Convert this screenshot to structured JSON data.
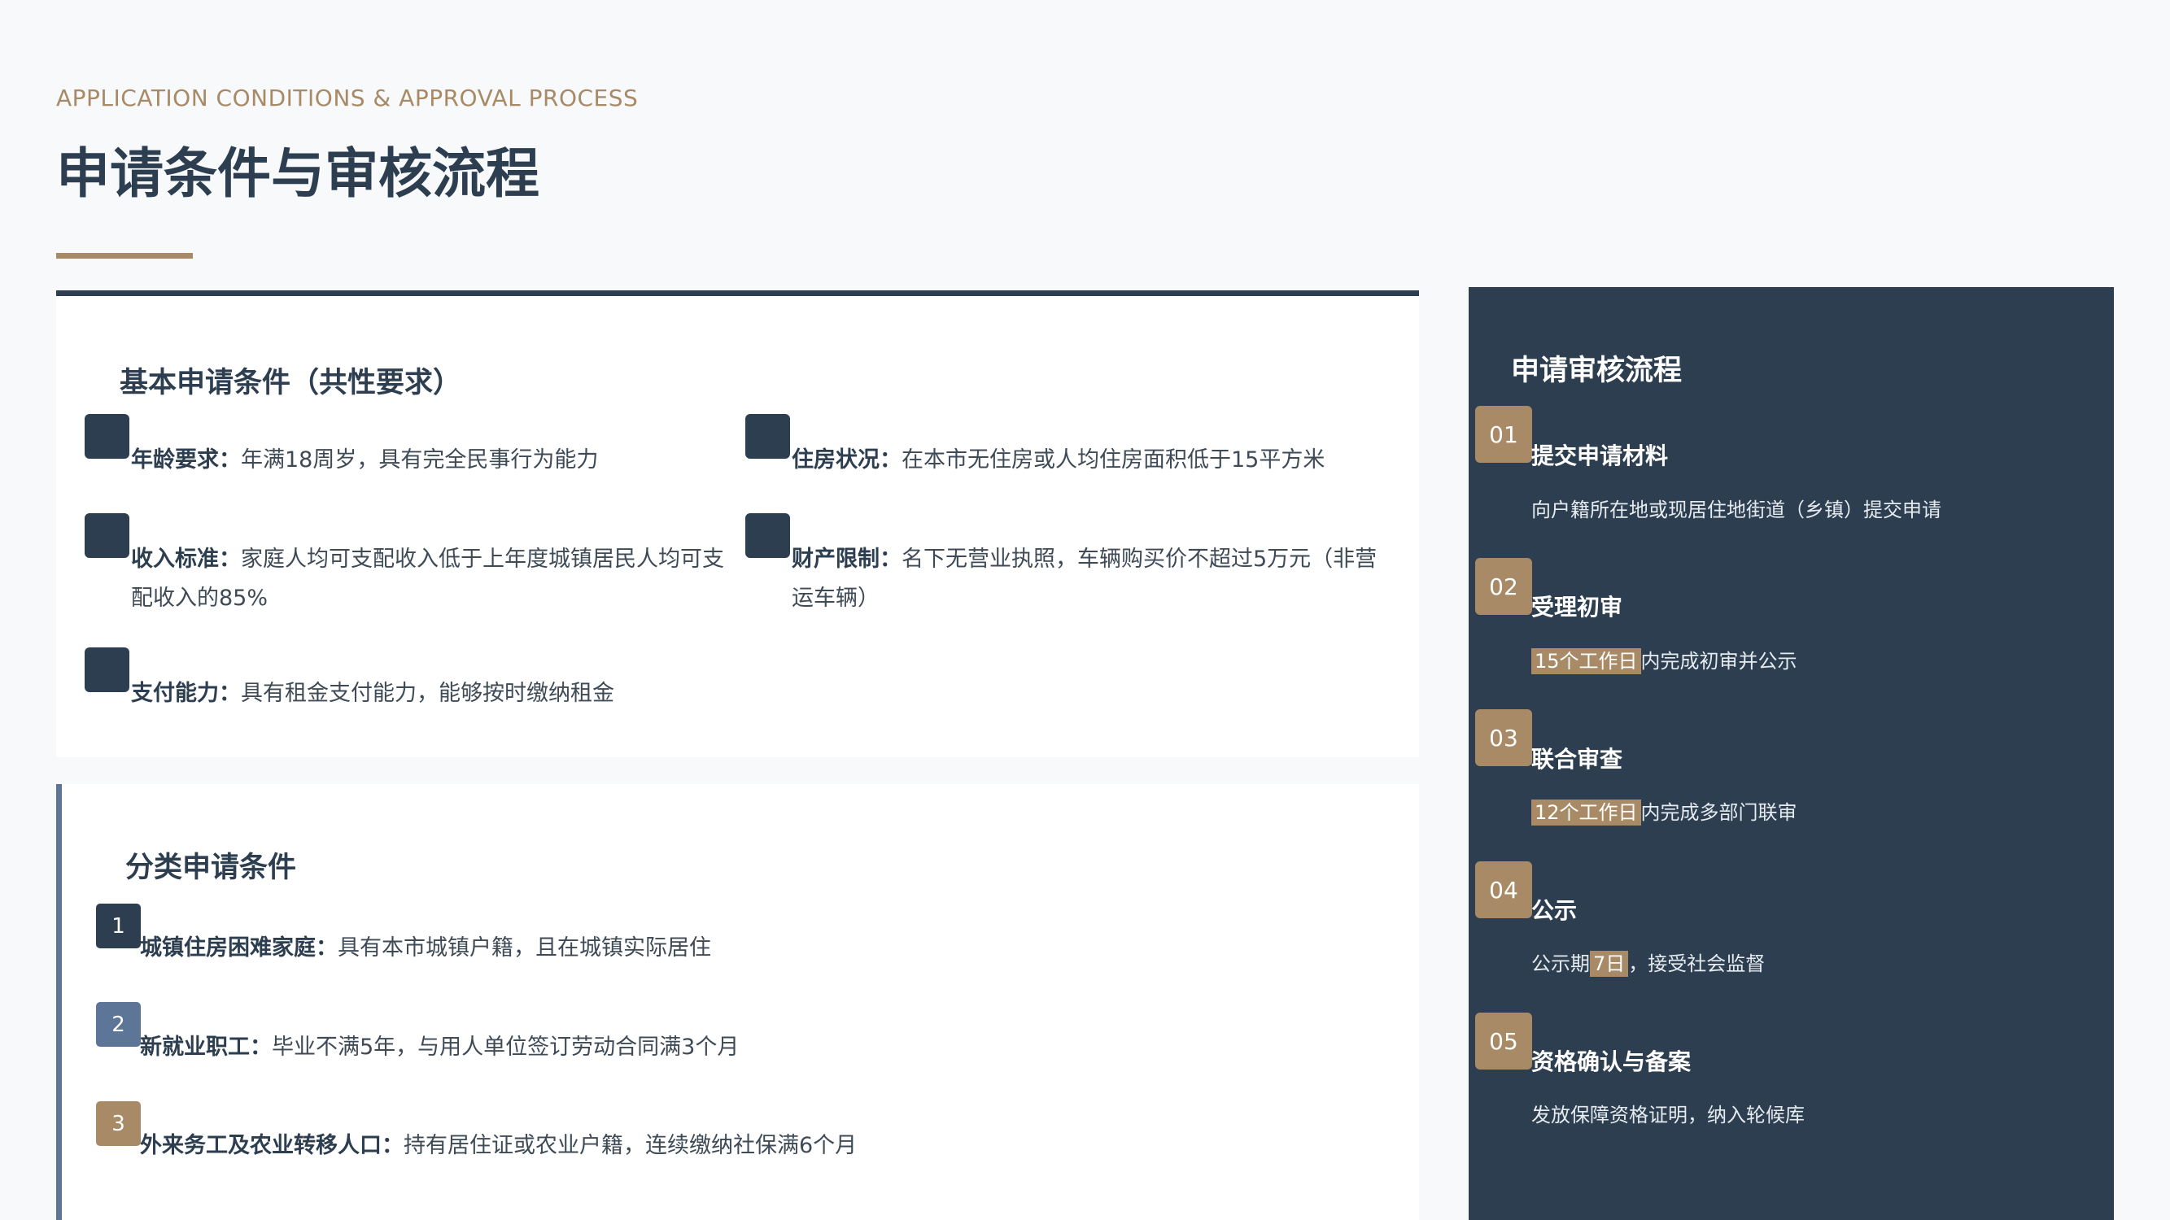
{
  "header": {
    "eyebrow": "APPLICATION CONDITIONS & APPROVAL PROCESS",
    "title": "申请条件与审核流程"
  },
  "basic": {
    "heading": "基本申请条件（共性要求）",
    "items": [
      {
        "label": "年龄要求：",
        "text": "年满18周岁，具有完全民事行为能力"
      },
      {
        "label": "住房状况：",
        "text": "在本市无住房或人均住房面积低于15平方米"
      },
      {
        "label": "收入标准：",
        "text": "家庭人均可支配收入低于上年度城镇居民人均可支配收入的85%"
      },
      {
        "label": "财产限制：",
        "text": "名下无营业执照，车辆购买价不超过5万元（非营运车辆）"
      },
      {
        "label": "支付能力：",
        "text": "具有租金支付能力，能够按时缴纳租金"
      }
    ]
  },
  "category": {
    "heading": "分类申请条件",
    "items": [
      {
        "num": "1",
        "color": "#2c3e50",
        "label": "城镇住房困难家庭：",
        "text": "具有本市城镇户籍，且在城镇实际居住"
      },
      {
        "num": "2",
        "color": "#5d7596",
        "label": "新就业职工：",
        "text": "毕业不满5年，与用人单位签订劳动合同满3个月"
      },
      {
        "num": "3",
        "color": "#a88a66",
        "label": "外来务工及农业转移人口：",
        "text": "持有居住证或农业户籍，连续缴纳社保满6个月"
      }
    ]
  },
  "process": {
    "heading": "申请审核流程",
    "steps": [
      {
        "num": "01",
        "title": "提交申请材料",
        "pre": "向户籍所在地或现居住地街道（乡镇）提交申请",
        "hl": "",
        "post": ""
      },
      {
        "num": "02",
        "title": "受理初审",
        "pre": "",
        "hl": "15个工作日",
        "post": "内完成初审并公示"
      },
      {
        "num": "03",
        "title": "联合审查",
        "pre": "",
        "hl": "12个工作日",
        "post": "内完成多部门联审"
      },
      {
        "num": "04",
        "title": "公示",
        "pre": "公示期",
        "hl": "7日",
        "post": "，接受社会监督"
      },
      {
        "num": "05",
        "title": "资格确认与备案",
        "pre": "发放保障资格证明，纳入轮候库",
        "hl": "",
        "post": ""
      }
    ]
  }
}
